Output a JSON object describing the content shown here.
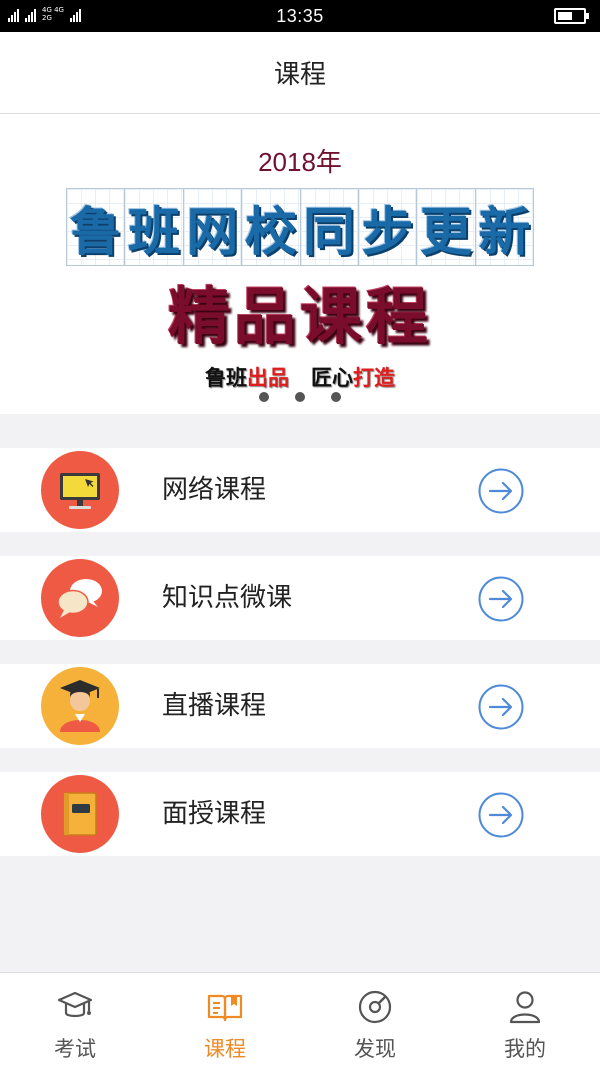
{
  "status_bar": {
    "network_top": "4G 4G",
    "network_bottom": "2G",
    "signal_small": "2G",
    "time": "13:35",
    "battery_level": 0.6
  },
  "header": {
    "title": "课程"
  },
  "banner": {
    "year": "2018年",
    "headline_chars": [
      "鲁",
      "班",
      "网",
      "校",
      "同",
      "步",
      "更",
      "新"
    ],
    "main_title": "精品课程",
    "slogan_a1": "鲁班",
    "slogan_a2": "出品",
    "slogan_b1": "匠心",
    "slogan_b2": "打造",
    "slide_count": 3,
    "colors": {
      "year": "#6e1230",
      "headline": "#1b6aa8",
      "main": "#7a0c2c",
      "highlight": "#e11c1c"
    }
  },
  "courses": [
    {
      "label": "网络课程",
      "icon": "monitor-icon",
      "color": "#ee5a44"
    },
    {
      "label": "知识点微课",
      "icon": "chat-bubbles-icon",
      "color": "#ee5a44"
    },
    {
      "label": "直播课程",
      "icon": "graduate-icon",
      "color": "#f6b13a"
    },
    {
      "label": "面授课程",
      "icon": "book-icon",
      "color": "#ee5a44"
    }
  ],
  "tab_bar": {
    "active_color": "#f08a24",
    "inactive_color": "#555555",
    "tabs": [
      {
        "label": "考试",
        "icon": "mortarboard-icon",
        "active": false
      },
      {
        "label": "课程",
        "icon": "book-open-icon",
        "active": true
      },
      {
        "label": "发现",
        "icon": "compass-icon",
        "active": false
      },
      {
        "label": "我的",
        "icon": "user-icon",
        "active": false
      }
    ]
  }
}
